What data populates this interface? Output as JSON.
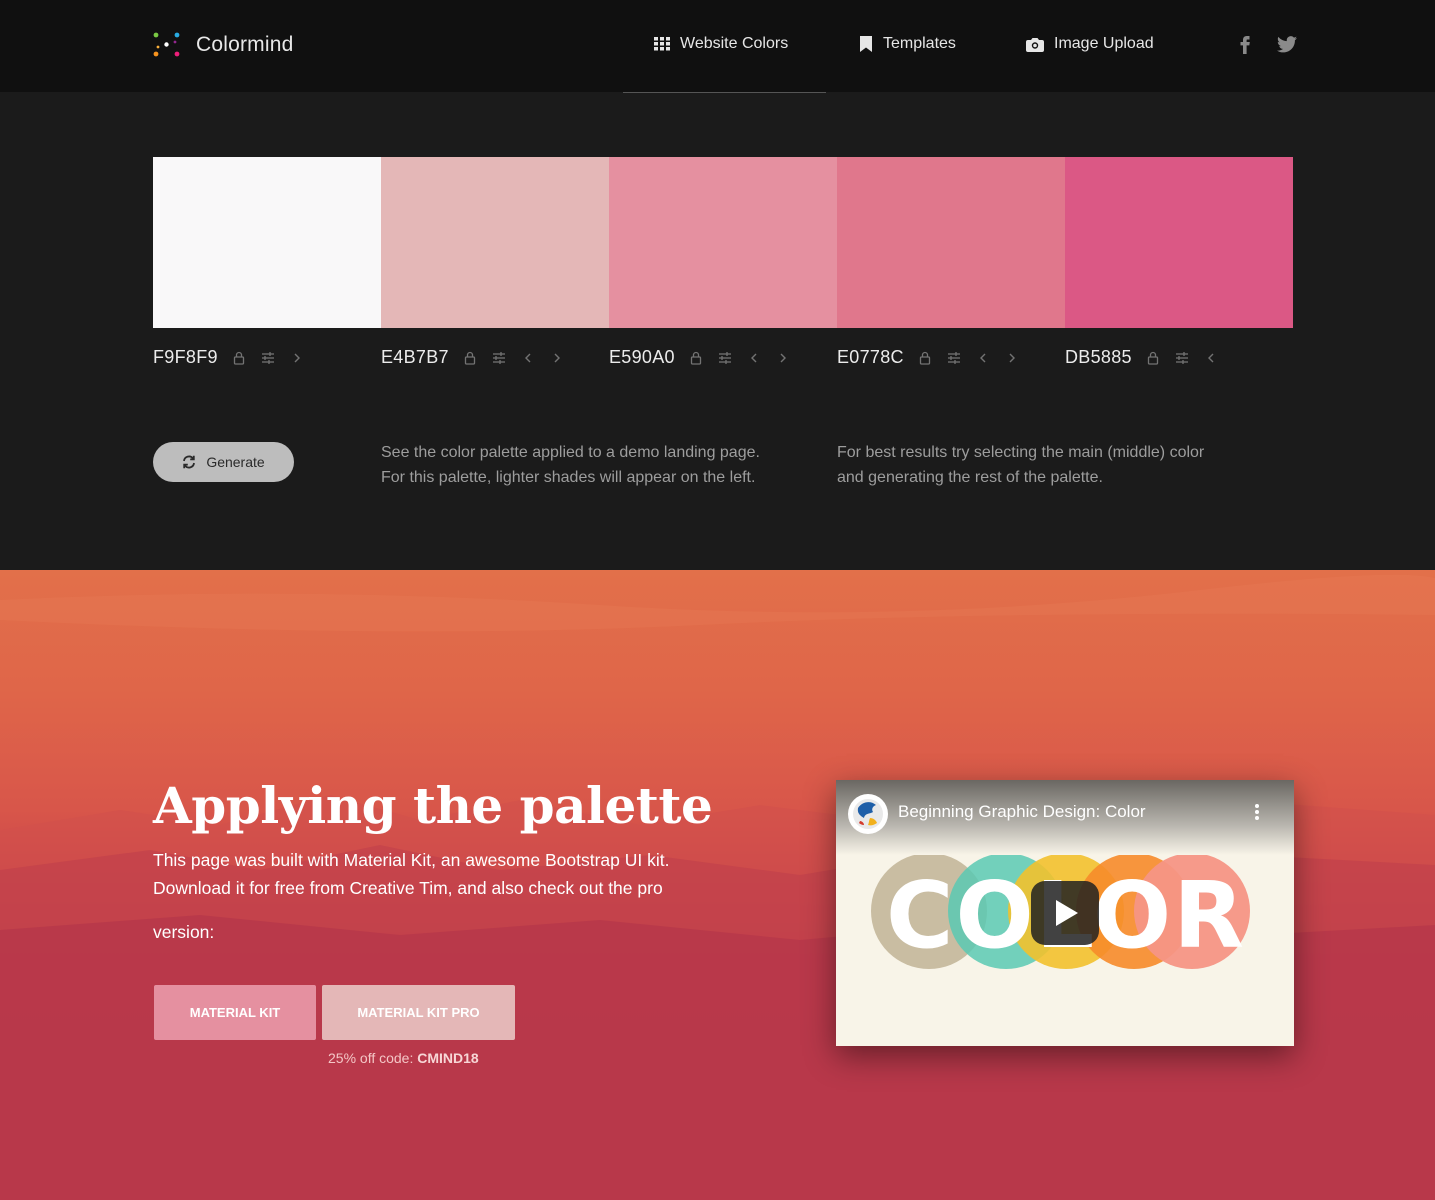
{
  "nav": {
    "brand": "Colormind",
    "items": [
      {
        "label": "Website Colors",
        "icon": "grid-icon"
      },
      {
        "label": "Templates",
        "icon": "bookmark-icon"
      },
      {
        "label": "Image Upload",
        "icon": "camera-icon"
      }
    ],
    "social": [
      "facebook-icon",
      "twitter-icon"
    ]
  },
  "palette": [
    {
      "hex": "F9F8F9",
      "color": "#F9F8F9"
    },
    {
      "hex": "E4B7B7",
      "color": "#E4B7B7"
    },
    {
      "hex": "E590A0",
      "color": "#E590A0"
    },
    {
      "hex": "E0778C",
      "color": "#E0778C"
    },
    {
      "hex": "DB5885",
      "color": "#DB5885"
    }
  ],
  "generate_label": "Generate",
  "info": {
    "left": [
      "See the color palette applied to a demo landing page.",
      "For this palette, lighter shades will appear on the left."
    ],
    "right": [
      "For best results try selecting the main (middle) color",
      "and generating the rest of the palette."
    ]
  },
  "hero": {
    "title": "Applying the palette",
    "text_line1": "This page was built with Material Kit, an awesome Bootstrap UI kit.",
    "text_line2": "Download it for free from Creative Tim, and also check out the pro",
    "text_line3": "version:",
    "button1": "MATERIAL KIT",
    "button2": "MATERIAL KIT PRO",
    "promo_prefix": "25% off code: ",
    "promo_code": "CMIND18"
  },
  "video": {
    "title": "Beginning Graphic Design: Color",
    "art_text": "COLOR"
  }
}
